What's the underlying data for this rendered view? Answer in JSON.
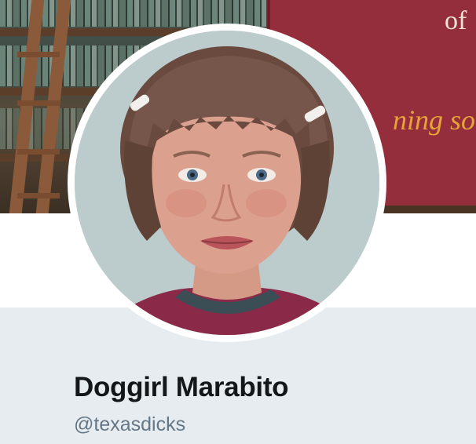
{
  "header": {
    "sign_text_top": "of",
    "sign_text_mid": "ning so"
  },
  "profile": {
    "display_name": "Doggirl Marabito",
    "handle": "@texasdicks"
  },
  "colors": {
    "name_text": "#14171a",
    "handle_text": "#657786",
    "profile_band": "#e6ecf0",
    "sign_background": "#952e3c",
    "sign_accent_text": "#e8a23a"
  }
}
